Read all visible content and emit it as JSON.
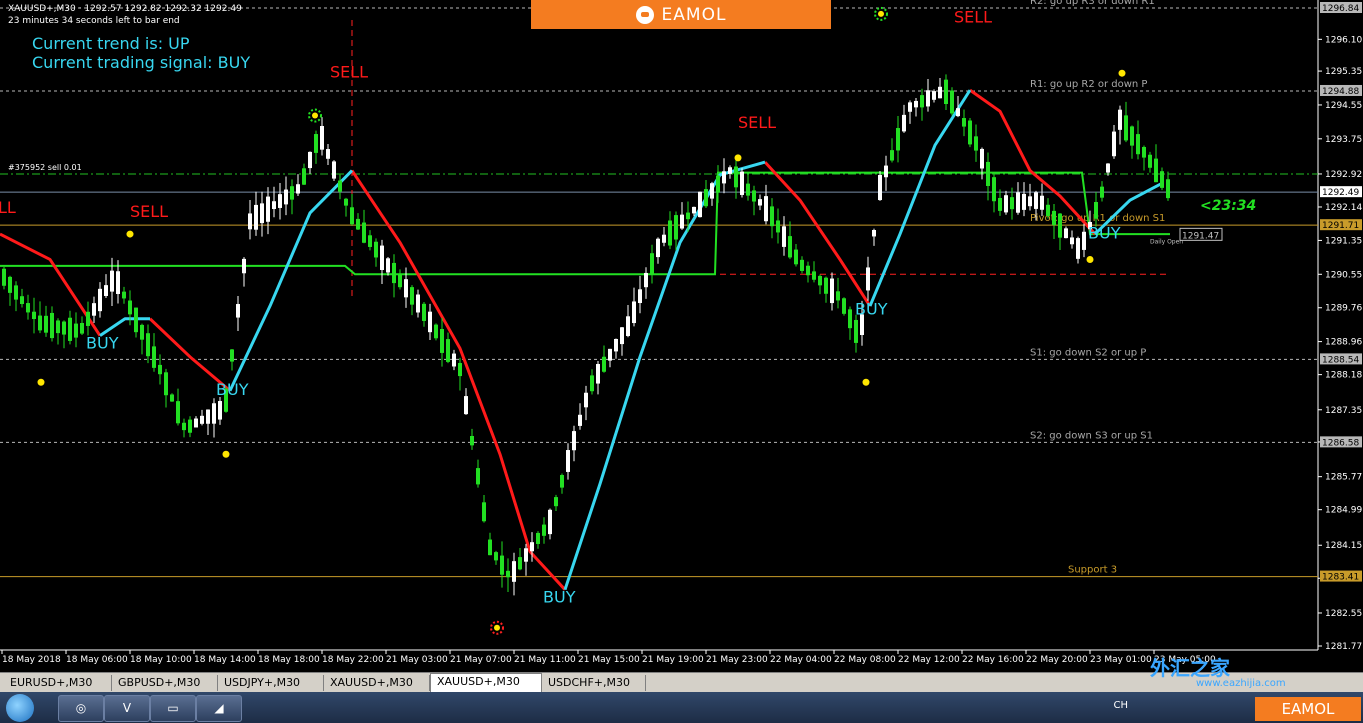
{
  "chart_header": {
    "symbol_line": "XAUUSD+,M30 · 1292.57 1292.82 1292.32 1292.49",
    "timer_line": "23 minutes 34 seconds left to bar end"
  },
  "trend_info": {
    "trend_line": "Current trend is: UP",
    "signal_line": "Current trading signal: BUY"
  },
  "banner": {
    "brand": "EAMOL"
  },
  "order_label": "#375952 sell 0.01",
  "countdown": "<23:34",
  "colors": {
    "sell": "#ff1a1a",
    "buy": "#38d7f0",
    "green_line": "#22e022",
    "up_candle": "#ffffff",
    "down_candle": "#22e022",
    "level_gold": "#c89b2a",
    "grid": "#b8b8b8"
  },
  "price_axis": {
    "ticks": [
      "1296.10",
      "1295.35",
      "1294.55",
      "1293.75",
      "1292.92",
      "1292.14",
      "1291.35",
      "1290.55",
      "1289.76",
      "1288.96",
      "1288.18",
      "1287.35",
      "1286.59",
      "1285.77",
      "1284.99",
      "1284.15",
      "1283.37",
      "1282.55",
      "1281.77"
    ],
    "badges": [
      {
        "label": "1296.84",
        "price": 1296.84,
        "style": "gray"
      },
      {
        "label": "1294.88",
        "price": 1294.88,
        "style": "gray"
      },
      {
        "label": "1292.49",
        "price": 1292.49,
        "style": "white"
      },
      {
        "label": "1291.71",
        "price": 1291.71,
        "style": "gold"
      },
      {
        "label": "1288.54",
        "price": 1288.54,
        "style": "gray"
      },
      {
        "label": "1286.58",
        "price": 1286.58,
        "style": "gray"
      },
      {
        "label": "1283.41",
        "price": 1283.41,
        "style": "gold"
      }
    ]
  },
  "time_axis": {
    "labels": [
      "18 May 2018",
      "18 May 06:00",
      "18 May 10:00",
      "18 May 14:00",
      "18 May 18:00",
      "18 May 22:00",
      "21 May 03:00",
      "21 May 07:00",
      "21 May 11:00",
      "21 May 15:00",
      "21 May 19:00",
      "21 May 23:00",
      "22 May 04:00",
      "22 May 08:00",
      "22 May 12:00",
      "22 May 16:00",
      "22 May 20:00",
      "23 May 01:00",
      "23 May 05:00"
    ]
  },
  "levels": [
    {
      "price": 1296.84,
      "text": "R2: go up R3 or down R1",
      "kind": "gray"
    },
    {
      "price": 1294.88,
      "text": "R1: go up R2 or down P",
      "kind": "gray"
    },
    {
      "price": 1291.71,
      "text": "Pivot: go up R1 or down S1",
      "kind": "gold"
    },
    {
      "price": 1288.54,
      "text": "S1: go down S2 or up P",
      "kind": "gray"
    },
    {
      "price": 1286.58,
      "text": "S2: go down S3 or up S1",
      "kind": "gray"
    },
    {
      "price": 1283.41,
      "text": "Support 3",
      "kind": "gold"
    }
  ],
  "daily_open": {
    "price": 1291.47,
    "label": "1291.47",
    "caption": "Daily Open"
  },
  "signals": [
    {
      "type": "SELL",
      "text": "LL"
    },
    {
      "type": "SELL",
      "text": "SELL"
    },
    {
      "type": "SELL",
      "text": "SELL"
    },
    {
      "type": "SELL",
      "text": "SELL"
    },
    {
      "type": "SELL",
      "text": "SELL"
    },
    {
      "type": "BUY",
      "text": "BUY"
    },
    {
      "type": "BUY",
      "text": "BUY"
    },
    {
      "type": "BUY",
      "text": "BUY"
    },
    {
      "type": "BUY",
      "text": "BUY"
    },
    {
      "type": "BUY",
      "text": "BUY"
    }
  ],
  "tabs": [
    "EURUSD+,M30",
    "GBPUSD+,M30",
    "USDJPY+,M30",
    "XAUUSD+,M30",
    "XAUUSD+,M30",
    "USDCHF+,M30"
  ],
  "active_tab": 4,
  "taskbar": {
    "tray_text": "CH"
  },
  "watermark": {
    "site_cn": "外汇之家",
    "site_url": "www.eazhijia.com",
    "brand": "EAMOL"
  }
}
